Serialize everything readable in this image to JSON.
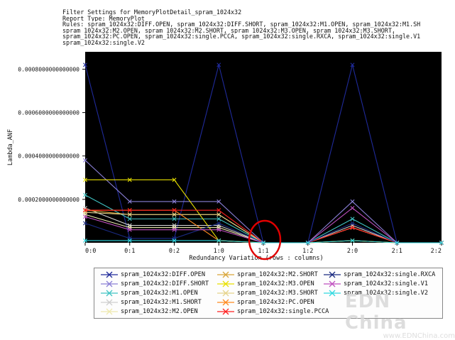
{
  "header": {
    "lines": [
      "Filter Settings for MemoryPlotDetail_spram_1024x32",
      "Report Type: MemoryPlot",
      "Rules: spram_1024x32:DIFF.OPEN, spram_1024x32:DIFF.SHORT, spram_1024x32:M1.OPEN, spram_1024x32:M1.SH",
      "spram_1024x32:M2.OPEN, spram_1024x32:M2.SHORT, spram_1024x32:M3.OPEN, spram_1024x32:M3.SHORT,",
      "spram_1024x32:PC.OPEN, spram_1024x32:single.PCCA, spram_1024x32:single.RXCA, spram_1024x32:single.V1",
      "spram_1024x32:single.V2"
    ]
  },
  "colors": {
    "plot_background": "#000000",
    "highlight_circle": "#e00000"
  },
  "chart_data": {
    "type": "line",
    "xlabel": "Redundancy Variation (rows : columns)",
    "ylabel": "Lambda_ANF",
    "categories": [
      "0:0",
      "0:1",
      "0:2",
      "1:0",
      "1:1",
      "1:2",
      "2:0",
      "2:1",
      "2:2"
    ],
    "ylim": [
      0,
      0.00088
    ],
    "yticks": [
      0.0002,
      0.0004,
      0.0006,
      0.0008
    ],
    "ytick_labels": [
      "0.0002000000000000",
      "0.0004000000000000",
      "0.0006000000000000",
      "0.0008000000000000"
    ],
    "highlight_category": "1:1",
    "legend_position": "bottom",
    "series": [
      {
        "name": "spram_1024x32:DIFF.OPEN",
        "color": "#1f2a9a",
        "values": [
          0.00082,
          2e-05,
          2e-05,
          0.00082,
          0,
          0,
          0.00082,
          0,
          0
        ]
      },
      {
        "name": "spram_1024x32:DIFF.SHORT",
        "color": "#8a7fd6",
        "values": [
          0.00038,
          0.00019,
          0.00019,
          0.00019,
          0,
          0,
          0.00019,
          0,
          0
        ]
      },
      {
        "name": "spram_1024x32:M1.OPEN",
        "color": "#40c4c4",
        "values": [
          0.00022,
          0.00011,
          0.00011,
          0.00011,
          0,
          0,
          0.00011,
          0,
          0
        ]
      },
      {
        "name": "spram_1024x32:M1.SHORT",
        "color": "#cfcfcf",
        "values": [
          0.00016,
          8e-05,
          8e-05,
          8e-05,
          0,
          0,
          8e-05,
          0,
          0
        ]
      },
      {
        "name": "spram_1024x32:M2.OPEN",
        "color": "#eee9b0",
        "values": [
          0.00013,
          7e-05,
          7e-05,
          7e-05,
          0,
          0,
          7e-05,
          0,
          0
        ]
      },
      {
        "name": "spram_1024x32:M2.SHORT",
        "color": "#d9a63a",
        "values": [
          0.00015,
          0.00013,
          0.00013,
          0.00013,
          0,
          0,
          7e-05,
          0,
          0
        ]
      },
      {
        "name": "spram_1024x32:M3.OPEN",
        "color": "#e8e000",
        "values": [
          0.00029,
          0.00029,
          0.00029,
          1e-05,
          0,
          0,
          1e-05,
          0,
          0
        ]
      },
      {
        "name": "spram_1024x32:M3.SHORT",
        "color": "#e6d48c",
        "values": [
          0.00014,
          0.00013,
          0.00013,
          0.00013,
          0,
          0,
          7e-05,
          0,
          0
        ]
      },
      {
        "name": "spram_1024x32:PC.OPEN",
        "color": "#ff8a20",
        "values": [
          0.00015,
          0.00015,
          0.00015,
          1e-05,
          0,
          0,
          1e-05,
          0,
          0
        ]
      },
      {
        "name": "spram_1024x32:single.PCCA",
        "color": "#ff2020",
        "values": [
          0.00015,
          0.00015,
          0.00015,
          0.00015,
          0,
          0,
          7e-05,
          0,
          0
        ]
      },
      {
        "name": "spram_1024x32:single.RXCA",
        "color": "#1a2a80",
        "values": [
          9e-05,
          2e-05,
          2e-05,
          9e-05,
          0,
          0,
          9e-05,
          0,
          0
        ]
      },
      {
        "name": "spram_1024x32:single.V1",
        "color": "#c050c0",
        "values": [
          0.00012,
          6e-05,
          6e-05,
          6e-05,
          0,
          0,
          0.00016,
          0,
          0
        ]
      },
      {
        "name": "spram_1024x32:single.V2",
        "color": "#30d8e0",
        "values": [
          1e-05,
          1e-05,
          1e-05,
          1e-05,
          0,
          0,
          1e-05,
          0,
          0
        ]
      }
    ]
  },
  "watermark": {
    "big": "EDN China",
    "small": "www.EDNChina.com"
  }
}
